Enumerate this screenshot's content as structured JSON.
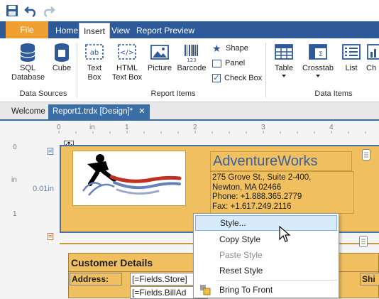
{
  "ribbon_tabs": {
    "file": "File",
    "home": "Home",
    "insert": "Insert",
    "view": "View",
    "preview": "Report Preview"
  },
  "ribbon": {
    "data_sources": {
      "sql_database_line1": "SQL",
      "sql_database_line2": "Database",
      "cube": "Cube",
      "group_label": "Data Sources"
    },
    "report_items": {
      "textbox_line1": "Text",
      "textbox_line2": "Box",
      "htmltextbox_line1": "HTML",
      "htmltextbox_line2": "Text Box",
      "picture": "Picture",
      "barcode": "Barcode",
      "shape": "Shape",
      "panel": "Panel",
      "checkbox": "Check Box",
      "group_label": "Report Items"
    },
    "data_items": {
      "table": "Table",
      "crosstab": "Crosstab",
      "list": "List",
      "chart": "Ch",
      "group_label": "Data Items"
    }
  },
  "doc_tabs": {
    "welcome": "Welcome",
    "report": "Report1.trdx [Design]*",
    "close": "✕"
  },
  "ruler": {
    "h": [
      "0",
      "in",
      "1",
      "2",
      "3",
      "4"
    ],
    "v": [
      "0",
      "in",
      "1"
    ],
    "margin_label": "0.01in"
  },
  "report": {
    "company": "AdventureWorks",
    "address_lines": [
      "275 Grove St., Suite 2-400,",
      "Newton, MA 02466",
      "Phone: +1.888.365.2779",
      "Fax: +1.617.249.2116"
    ],
    "customer_title": "Customer Details",
    "address_label": "Address:",
    "field_store": "[=Fields.Store]",
    "field_billaddress": "[=Fields.BillAd",
    "ship_label": "Shi"
  },
  "context_menu": {
    "items": [
      "Style...",
      "Copy Style",
      "Paste Style",
      "Reset Style",
      "Bring To Front"
    ]
  },
  "colors": {
    "ribbon_tab_bar": "#2e5a9a",
    "file_tab": "#f0a030",
    "band_fill": "#f0c060",
    "brand_text": "#3a5fa0"
  }
}
